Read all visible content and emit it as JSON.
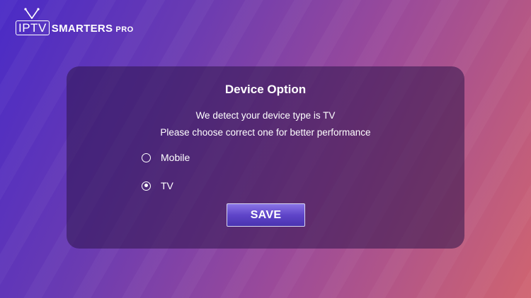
{
  "logo": {
    "iptv": "IPTV",
    "smarters": "SMARTERS",
    "pro": "PRO"
  },
  "dialog": {
    "title": "Device Option",
    "message_line1": "We detect your device type is TV",
    "message_line2": "Please choose correct one for better performance",
    "options": [
      {
        "label": "Mobile",
        "selected": false
      },
      {
        "label": "TV",
        "selected": true
      }
    ],
    "save_label": "SAVE"
  },
  "colors": {
    "background_start": "#4a2bc6",
    "background_end": "#d06470",
    "dialog_background": "#2d144b",
    "button_accent": "#5f45c9"
  }
}
